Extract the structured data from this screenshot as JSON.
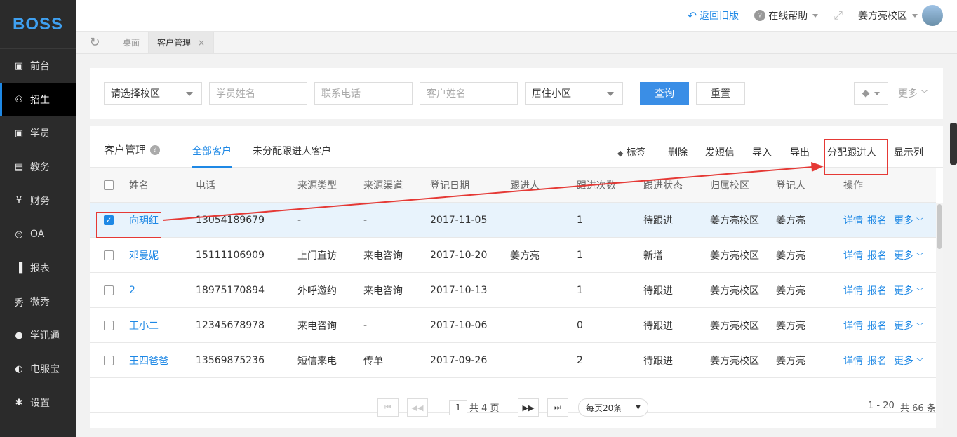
{
  "app": {
    "logo": "BOSS"
  },
  "sidebar": {
    "items": [
      {
        "label": "前台",
        "icon": "calendar-icon",
        "glyph": "▣"
      },
      {
        "label": "招生",
        "icon": "add-user-icon",
        "glyph": "⚇"
      },
      {
        "label": "学员",
        "icon": "student-icon",
        "glyph": "▣"
      },
      {
        "label": "教务",
        "icon": "book-icon",
        "glyph": "▤"
      },
      {
        "label": "财务",
        "icon": "yen-icon",
        "glyph": "¥"
      },
      {
        "label": "OA",
        "icon": "oa-icon",
        "glyph": "◎"
      },
      {
        "label": "报表",
        "icon": "bar-chart-icon",
        "glyph": "▐"
      },
      {
        "label": "微秀",
        "icon": "show-icon",
        "glyph": "秀"
      },
      {
        "label": "学讯通",
        "icon": "location-icon",
        "glyph": "●"
      },
      {
        "label": "电服宝",
        "icon": "phone-icon",
        "glyph": "◐"
      },
      {
        "label": "设置",
        "icon": "gear-icon",
        "glyph": "✱"
      }
    ]
  },
  "topbar": {
    "back": "返回旧版",
    "help": "在线帮助",
    "campus": "姜方亮校区"
  },
  "tabs": {
    "home": "桌面",
    "current": "客户管理",
    "close": "×"
  },
  "filter": {
    "campus": "请选择校区",
    "student_placeholder": "学员姓名",
    "phone_placeholder": "联系电话",
    "customer_placeholder": "客户姓名",
    "community": "居住小区",
    "query": "查询",
    "reset": "重置",
    "more": "更多"
  },
  "main": {
    "title": "客户管理",
    "tab_all": "全部客户",
    "tab_unassigned": "未分配跟进人客户",
    "actions": {
      "tag": "标签",
      "delete": "删除",
      "sms": "发短信",
      "import": "导入",
      "export": "导出",
      "assign": "分配跟进人",
      "columns": "显示列"
    }
  },
  "table": {
    "headers": [
      "姓名",
      "电话",
      "来源类型",
      "来源渠道",
      "登记日期",
      "跟进人",
      "跟进次数",
      "跟进状态",
      "归属校区",
      "登记人",
      "操作"
    ],
    "rows": [
      {
        "name": "向玥红",
        "phone": "13054189679",
        "type": "-",
        "channel": "-",
        "date": "2017-11-05",
        "follower": "",
        "count": "1",
        "status": "待跟进",
        "campus": "姜方亮校区",
        "registrar": "姜方亮",
        "checked": true
      },
      {
        "name": "邓曼妮",
        "phone": "15111106909",
        "type": "上门直访",
        "channel": "来电咨询",
        "date": "2017-10-20",
        "follower": "姜方亮",
        "count": "1",
        "status": "新增",
        "campus": "姜方亮校区",
        "registrar": "姜方亮",
        "checked": false
      },
      {
        "name": "2",
        "phone": "18975170894",
        "type": "外呼邀约",
        "channel": "来电咨询",
        "date": "2017-10-13",
        "follower": "",
        "count": "1",
        "status": "待跟进",
        "campus": "姜方亮校区",
        "registrar": "姜方亮",
        "checked": false
      },
      {
        "name": "王小二",
        "phone": "12345678978",
        "type": "来电咨询",
        "channel": "-",
        "date": "2017-10-06",
        "follower": "",
        "count": "0",
        "status": "待跟进",
        "campus": "姜方亮校区",
        "registrar": "姜方亮",
        "checked": false
      },
      {
        "name": "王四爸爸",
        "phone": "13569875236",
        "type": "短信来电",
        "channel": "传单",
        "date": "2017-09-26",
        "follower": "",
        "count": "2",
        "status": "待跟进",
        "campus": "姜方亮校区",
        "registrar": "姜方亮",
        "checked": false
      }
    ],
    "row_actions": {
      "detail": "详情",
      "enroll": "报名",
      "more": "更多"
    }
  },
  "pager": {
    "page": "1",
    "total_pages": "共 4 页",
    "per_page": "每页20条",
    "range": "1 - 20",
    "total": "共 66 条"
  },
  "colors": {
    "accent": "#1e88e5",
    "annotation": "#e53935",
    "sidebar": "#2b2b2b"
  }
}
